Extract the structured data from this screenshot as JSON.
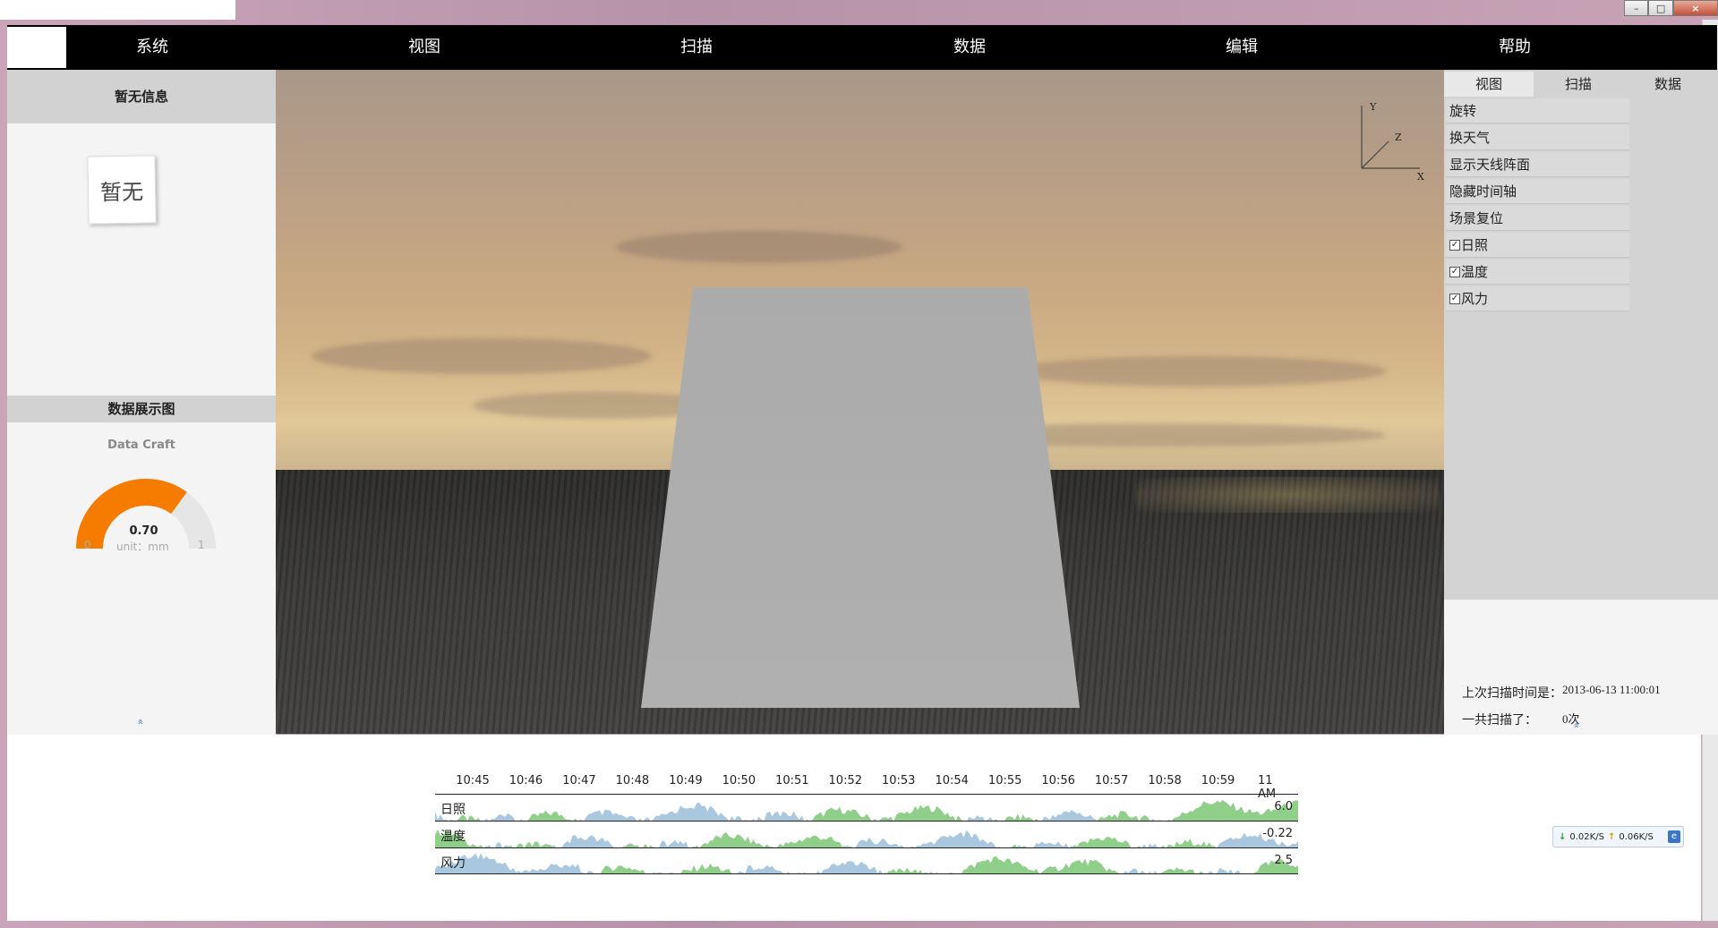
{
  "window": {
    "controls": [
      "–",
      "□",
      "×"
    ]
  },
  "menu": {
    "items": [
      "系统",
      "视图",
      "扫描",
      "数据",
      "编辑",
      "帮助"
    ]
  },
  "left_panel": {
    "header": "暂无信息",
    "placeholder_card": "暂无",
    "chart_header": "数据展示图",
    "gauge": {
      "title": "Data Craft",
      "value": 0.7,
      "value_label": "0.70",
      "min": "0",
      "max": "1",
      "unit_label": "unit：mm",
      "fill_color": "#f57c00",
      "track_color": "#e6e6e6"
    },
    "collapse_glyph": "»"
  },
  "right_panel": {
    "tabs": [
      "视图",
      "扫描",
      "数据"
    ],
    "active_tab": 0,
    "items": [
      {
        "label": "旋转",
        "checkbox": false
      },
      {
        "label": "换天气",
        "checkbox": false
      },
      {
        "label": "显示天线阵面",
        "checkbox": false
      },
      {
        "label": "隐藏时间轴",
        "checkbox": false
      },
      {
        "label": "场景复位",
        "checkbox": false
      },
      {
        "label": "日照",
        "checkbox": true,
        "checked": true
      },
      {
        "label": "温度",
        "checkbox": true,
        "checked": true
      },
      {
        "label": "风力",
        "checkbox": true,
        "checked": true
      }
    ],
    "scan": {
      "last_label": "上次扫描时间是：",
      "last_value": "2013-06-13 11:00:01",
      "count_label": "一共扫描了：",
      "count_value": "0次"
    },
    "collapse_glyph": "»"
  },
  "viewport": {
    "axis_labels": {
      "x": "X",
      "y": "Y",
      "z": "Z"
    }
  },
  "timeline": {
    "ticks": [
      "10:45",
      "10:46",
      "10:47",
      "10:48",
      "10:49",
      "10:50",
      "10:51",
      "10:52",
      "10:53",
      "10:54",
      "10:55",
      "10:56",
      "10:57",
      "10:58",
      "10:59",
      "11 AM"
    ],
    "rows": [
      {
        "label": "日照",
        "value": "6.0"
      },
      {
        "label": "温度",
        "value": "-0.22"
      },
      {
        "label": "风力",
        "value": "2.5"
      }
    ],
    "colors": {
      "positive": "#8fcf8a",
      "negative": "#a9c8e0",
      "positive_dark": "#3ea84a",
      "negative_dark": "#5b9bd0"
    }
  },
  "net_widget": {
    "down": "0.02K/S",
    "up": "0.06K/S"
  }
}
